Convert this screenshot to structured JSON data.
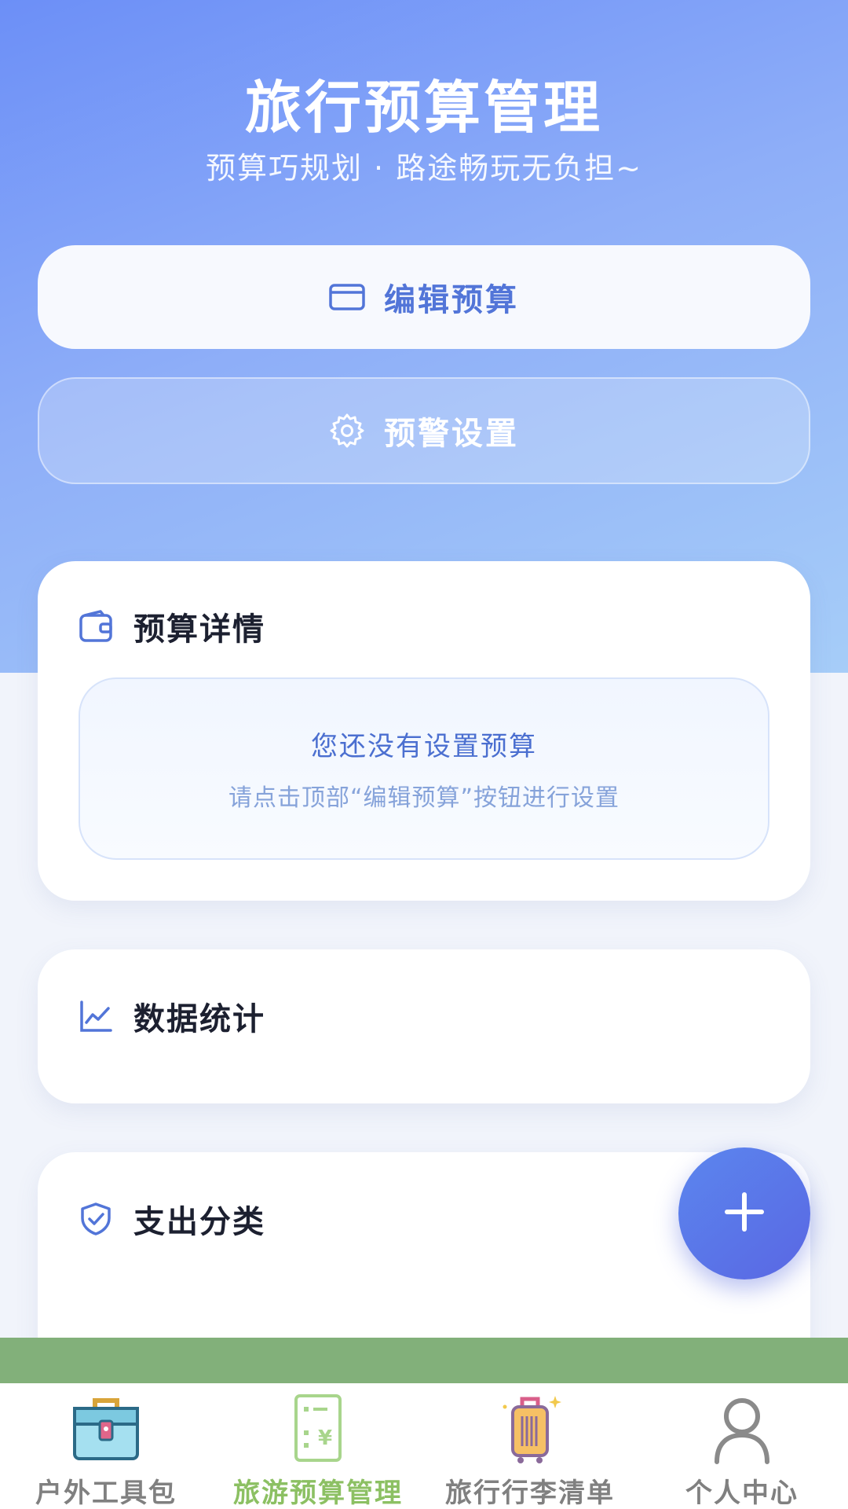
{
  "header": {
    "title": "旅行预算管理",
    "subtitle": "预算巧规划 · 路途畅玩无负担~"
  },
  "actions": {
    "edit_budget": {
      "label": "编辑预算",
      "icon": "credit-card-icon"
    },
    "alert_settings": {
      "label": "预警设置",
      "icon": "gear-icon"
    }
  },
  "budget_card": {
    "title": "预算详情",
    "icon": "wallet-icon",
    "empty_title": "您还没有设置预算",
    "empty_hint": "请点击顶部“编辑预算”按钮进行设置"
  },
  "stats_card": {
    "title": "数据统计",
    "icon": "line-chart-icon"
  },
  "category_card": {
    "title": "支出分类",
    "icon": "shield-check-icon"
  },
  "fab": {
    "icon": "plus-icon"
  },
  "tabbar": {
    "items": [
      {
        "label": "户外工具包",
        "icon": "toolbox-icon"
      },
      {
        "label": "旅游预算管理",
        "icon": "budget-calculator-icon",
        "active": true
      },
      {
        "label": "旅行行李清单",
        "icon": "luggage-icon"
      },
      {
        "label": "个人中心",
        "icon": "person-icon"
      }
    ]
  },
  "colors": {
    "accent": "#5275d8",
    "active_tab": "#8cc063",
    "inactive_tab": "#808080"
  }
}
